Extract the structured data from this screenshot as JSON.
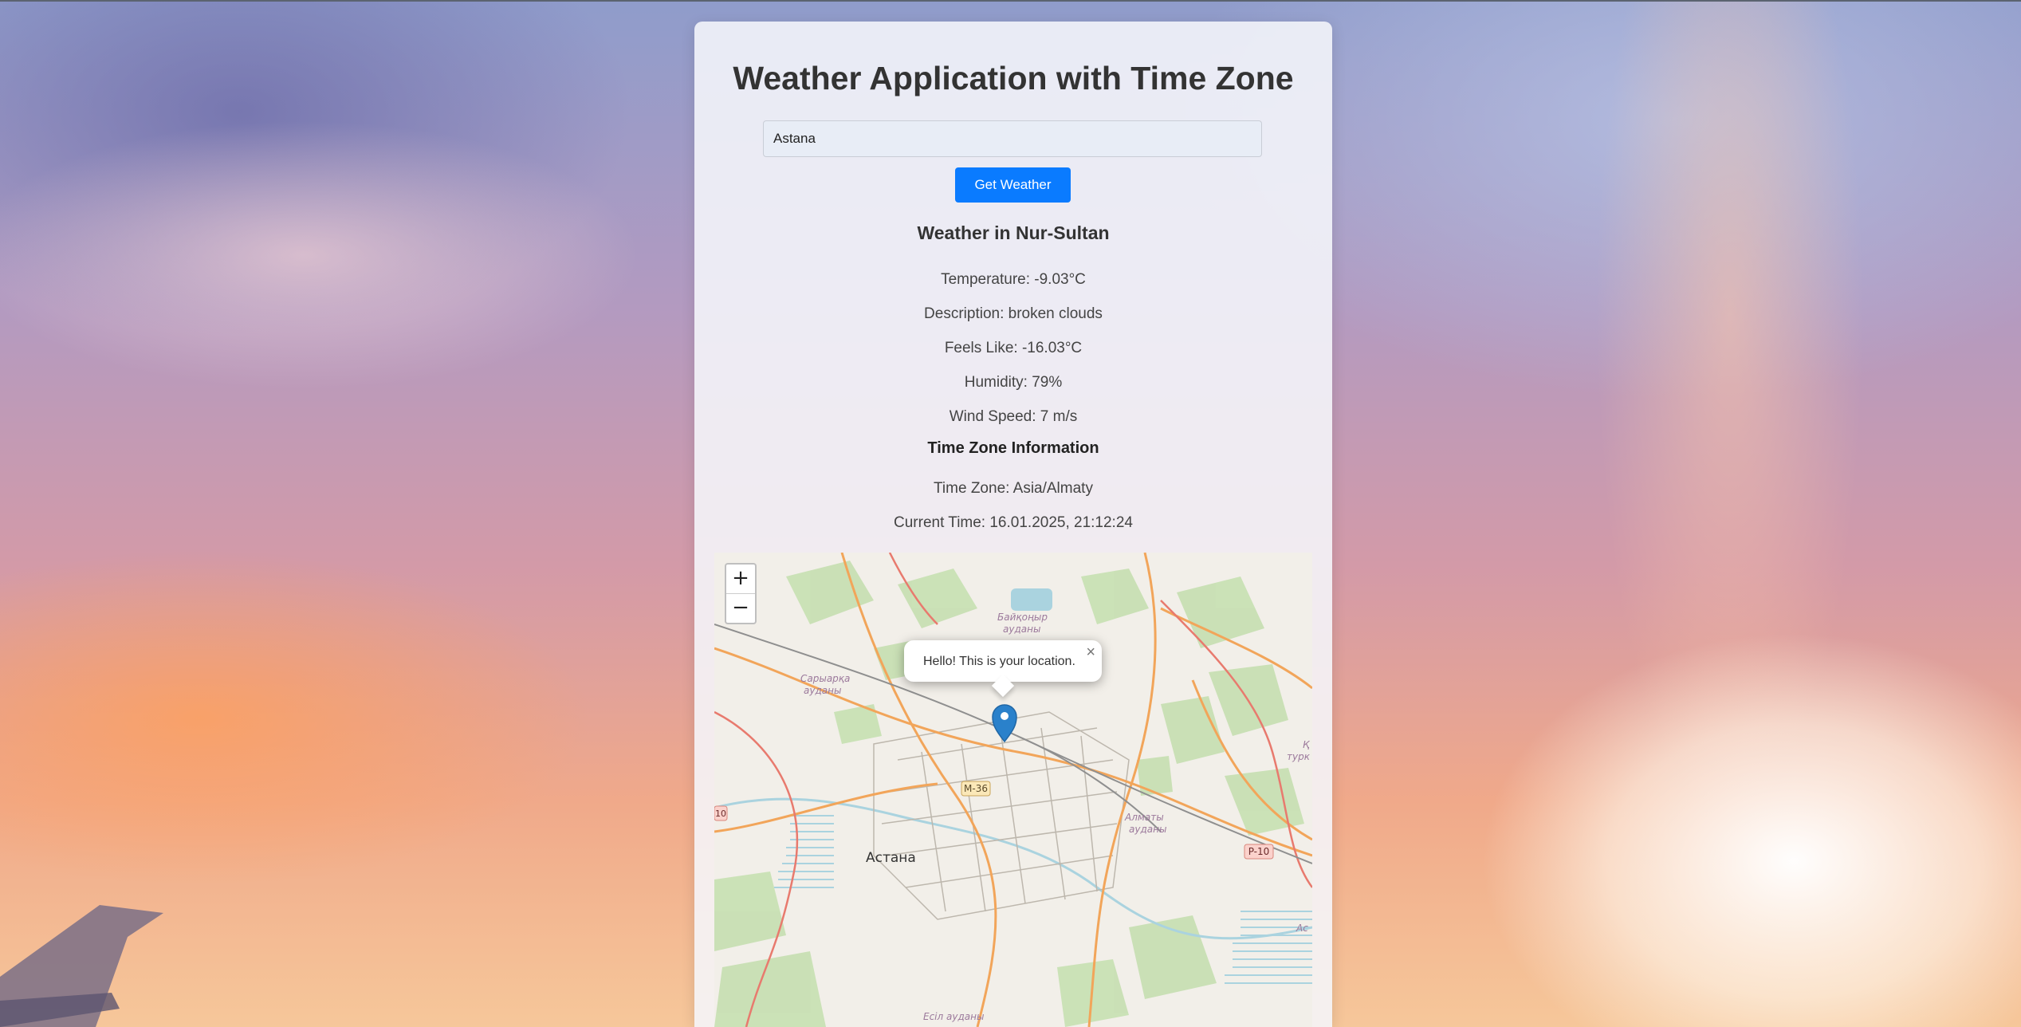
{
  "app": {
    "title": "Weather Application with Time Zone"
  },
  "search": {
    "value": "Astana",
    "button_label": "Get Weather"
  },
  "weather": {
    "heading": "Weather in Nur-Sultan",
    "temperature": "Temperature: -9.03°C",
    "description": "Description: broken clouds",
    "feels_like": "Feels Like: -16.03°C",
    "humidity": "Humidity: 79%",
    "wind_speed": "Wind Speed: 7 m/s"
  },
  "timezone": {
    "heading": "Time Zone Information",
    "zone": "Time Zone: Asia/Almaty",
    "current_time": "Current Time: 16.01.2025, 21:12:24"
  },
  "map": {
    "zoom_in": "+",
    "zoom_out": "−",
    "popup_text": "Hello! This is your location.",
    "popup_close": "×",
    "labels": {
      "city": "Астана",
      "district_baikonur_1": "Байқоңыр",
      "district_baikonur_2": "ауданы",
      "district_saryarka_1": "Сарыарқа",
      "district_saryarka_2": "ауданы",
      "district_almaty_1": "Алматы",
      "district_almaty_2": "ауданы",
      "district_esil": "Есіл ауданы",
      "road_m36": "M-36",
      "road_p10": "P-10",
      "edge_left": "10",
      "edge_right_1": "Қ",
      "edge_right_2": "турк",
      "edge_right_3": "Ас"
    }
  }
}
